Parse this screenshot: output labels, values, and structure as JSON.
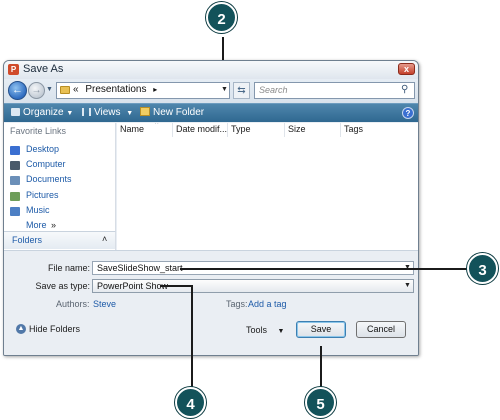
{
  "window": {
    "title": "Save As",
    "app_icon": "powerpoint-icon",
    "close_glyph": "x"
  },
  "address": {
    "back_glyph": "←",
    "forward_glyph": "→",
    "breadcrumb_prefix": "«",
    "current": "Presentations",
    "separator": "▸",
    "refresh_glyph": "⇆",
    "search_placeholder": "Search"
  },
  "toolbar": {
    "organize": "Organize",
    "views": "Views",
    "new_folder": "New Folder",
    "help_glyph": "?"
  },
  "nav": {
    "header": "Favorite Links",
    "items": [
      {
        "label": "Desktop",
        "icon": "desktop-icon",
        "color": "#3a6fd1"
      },
      {
        "label": "Computer",
        "icon": "computer-icon",
        "color": "#4a5a6a"
      },
      {
        "label": "Documents",
        "icon": "documents-icon",
        "color": "#6b8fb8"
      },
      {
        "label": "Pictures",
        "icon": "pictures-icon",
        "color": "#6e9e5a"
      },
      {
        "label": "Music",
        "icon": "music-icon",
        "color": "#4d7fc4"
      }
    ],
    "more": "More",
    "more_glyph": "»",
    "folders": "Folders",
    "folders_glyph": "˄"
  },
  "columns": [
    "Name",
    "Date modif...",
    "Type",
    "Size",
    "Tags"
  ],
  "form": {
    "file_name_label": "File name:",
    "file_name_value": "SaveSlideShow_start",
    "save_as_type_label": "Save as type:",
    "save_as_type_value": "PowerPoint Show",
    "authors_label": "Authors:",
    "authors_value": "Steve",
    "tags_label": "Tags:",
    "tags_value": "Add a tag",
    "hide_folders": "Hide Folders",
    "tools": "Tools",
    "save": "Save",
    "cancel": "Cancel",
    "drop_glyph": "▼"
  },
  "callouts": [
    "2",
    "3",
    "4",
    "5"
  ],
  "colors": {
    "callout": "#13525a",
    "toolbar": "#3c76a0",
    "link": "#1e5ba8"
  }
}
